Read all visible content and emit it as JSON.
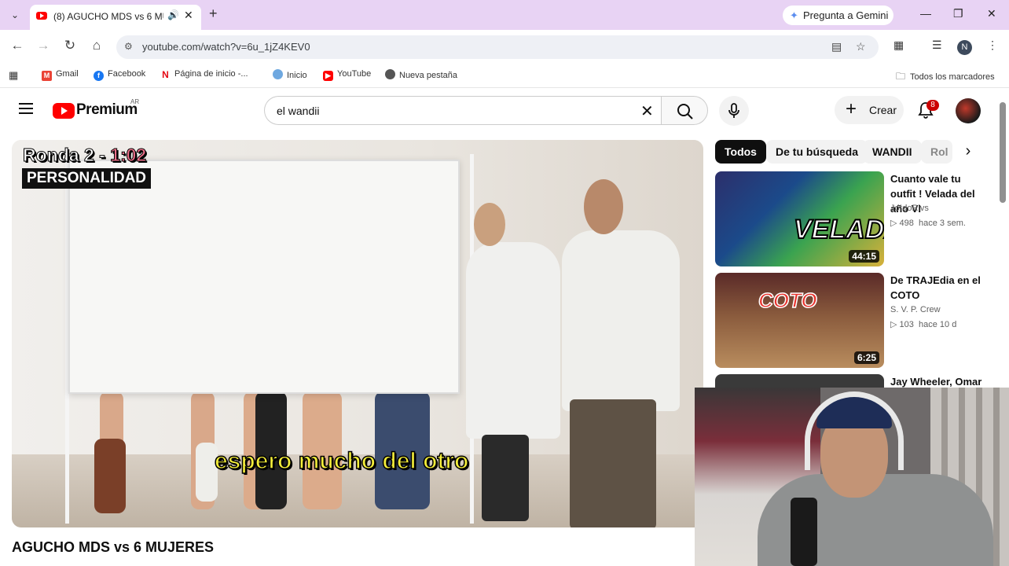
{
  "browser": {
    "tab_title": "(8) AGUCHO MDS vs 6 MUJERES",
    "new_tab": "+",
    "gemini_label": "Pregunta a Gemini",
    "url": "youtube.com/watch?v=6u_1jZ4KEV0",
    "profile_initial": "N",
    "bookmarks": [
      {
        "label": "Gmail"
      },
      {
        "label": "Facebook"
      },
      {
        "label": "Página de inicio -..."
      },
      {
        "label": "Inicio"
      },
      {
        "label": "YouTube"
      },
      {
        "label": "Nueva pestaña"
      }
    ],
    "all_bookmarks": "Todos los marcadores"
  },
  "youtube": {
    "logo_text": "Premium",
    "country": "AR",
    "search_query": "el wandii",
    "create_label": "Crear",
    "notification_count": "8"
  },
  "video": {
    "overlay_round": "Ronda 2 - ",
    "overlay_time": "1:02",
    "overlay_category": "PERSONALIDAD",
    "subtitle": "espero mucho del otro",
    "title": "AGUCHO MDS vs 6 MUJERES"
  },
  "chips": [
    {
      "label": "Todos"
    },
    {
      "label": "De tu búsqueda"
    },
    {
      "label": "WANDII"
    },
    {
      "label": "Rol"
    }
  ],
  "recommendations": [
    {
      "title": "Cuanto vale tu outfit ! Velada del año VI",
      "channel": "JordoRivs",
      "views": "498",
      "age": "hace 3 sem.",
      "duration": "44:15"
    },
    {
      "title": "De TRAJEdia en el COTO",
      "channel": "S. V. P. Crew",
      "views": "103",
      "age": "hace 10 d",
      "duration": "6:25"
    },
    {
      "title": "Jay Wheeler, Omar",
      "channel": "",
      "views": "",
      "age": "",
      "duration": ""
    }
  ]
}
